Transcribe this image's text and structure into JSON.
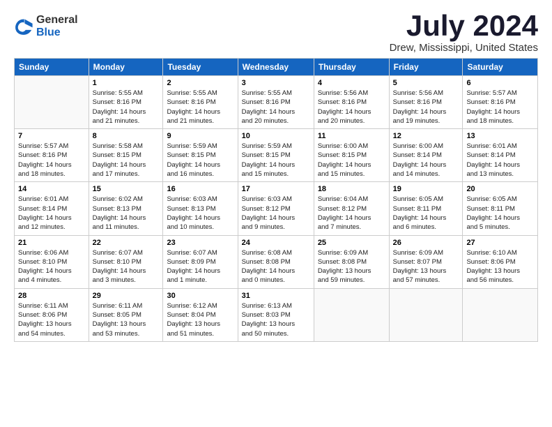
{
  "header": {
    "logo_general": "General",
    "logo_blue": "Blue",
    "month_title": "July 2024",
    "location": "Drew, Mississippi, United States"
  },
  "days_of_week": [
    "Sunday",
    "Monday",
    "Tuesday",
    "Wednesday",
    "Thursday",
    "Friday",
    "Saturday"
  ],
  "weeks": [
    [
      {
        "day": "",
        "info": ""
      },
      {
        "day": "1",
        "info": "Sunrise: 5:55 AM\nSunset: 8:16 PM\nDaylight: 14 hours\nand 21 minutes."
      },
      {
        "day": "2",
        "info": "Sunrise: 5:55 AM\nSunset: 8:16 PM\nDaylight: 14 hours\nand 21 minutes."
      },
      {
        "day": "3",
        "info": "Sunrise: 5:55 AM\nSunset: 8:16 PM\nDaylight: 14 hours\nand 20 minutes."
      },
      {
        "day": "4",
        "info": "Sunrise: 5:56 AM\nSunset: 8:16 PM\nDaylight: 14 hours\nand 20 minutes."
      },
      {
        "day": "5",
        "info": "Sunrise: 5:56 AM\nSunset: 8:16 PM\nDaylight: 14 hours\nand 19 minutes."
      },
      {
        "day": "6",
        "info": "Sunrise: 5:57 AM\nSunset: 8:16 PM\nDaylight: 14 hours\nand 18 minutes."
      }
    ],
    [
      {
        "day": "7",
        "info": "Sunrise: 5:57 AM\nSunset: 8:16 PM\nDaylight: 14 hours\nand 18 minutes."
      },
      {
        "day": "8",
        "info": "Sunrise: 5:58 AM\nSunset: 8:15 PM\nDaylight: 14 hours\nand 17 minutes."
      },
      {
        "day": "9",
        "info": "Sunrise: 5:59 AM\nSunset: 8:15 PM\nDaylight: 14 hours\nand 16 minutes."
      },
      {
        "day": "10",
        "info": "Sunrise: 5:59 AM\nSunset: 8:15 PM\nDaylight: 14 hours\nand 15 minutes."
      },
      {
        "day": "11",
        "info": "Sunrise: 6:00 AM\nSunset: 8:15 PM\nDaylight: 14 hours\nand 15 minutes."
      },
      {
        "day": "12",
        "info": "Sunrise: 6:00 AM\nSunset: 8:14 PM\nDaylight: 14 hours\nand 14 minutes."
      },
      {
        "day": "13",
        "info": "Sunrise: 6:01 AM\nSunset: 8:14 PM\nDaylight: 14 hours\nand 13 minutes."
      }
    ],
    [
      {
        "day": "14",
        "info": "Sunrise: 6:01 AM\nSunset: 8:14 PM\nDaylight: 14 hours\nand 12 minutes."
      },
      {
        "day": "15",
        "info": "Sunrise: 6:02 AM\nSunset: 8:13 PM\nDaylight: 14 hours\nand 11 minutes."
      },
      {
        "day": "16",
        "info": "Sunrise: 6:03 AM\nSunset: 8:13 PM\nDaylight: 14 hours\nand 10 minutes."
      },
      {
        "day": "17",
        "info": "Sunrise: 6:03 AM\nSunset: 8:12 PM\nDaylight: 14 hours\nand 9 minutes."
      },
      {
        "day": "18",
        "info": "Sunrise: 6:04 AM\nSunset: 8:12 PM\nDaylight: 14 hours\nand 7 minutes."
      },
      {
        "day": "19",
        "info": "Sunrise: 6:05 AM\nSunset: 8:11 PM\nDaylight: 14 hours\nand 6 minutes."
      },
      {
        "day": "20",
        "info": "Sunrise: 6:05 AM\nSunset: 8:11 PM\nDaylight: 14 hours\nand 5 minutes."
      }
    ],
    [
      {
        "day": "21",
        "info": "Sunrise: 6:06 AM\nSunset: 8:10 PM\nDaylight: 14 hours\nand 4 minutes."
      },
      {
        "day": "22",
        "info": "Sunrise: 6:07 AM\nSunset: 8:10 PM\nDaylight: 14 hours\nand 3 minutes."
      },
      {
        "day": "23",
        "info": "Sunrise: 6:07 AM\nSunset: 8:09 PM\nDaylight: 14 hours\nand 1 minute."
      },
      {
        "day": "24",
        "info": "Sunrise: 6:08 AM\nSunset: 8:08 PM\nDaylight: 14 hours\nand 0 minutes."
      },
      {
        "day": "25",
        "info": "Sunrise: 6:09 AM\nSunset: 8:08 PM\nDaylight: 13 hours\nand 59 minutes."
      },
      {
        "day": "26",
        "info": "Sunrise: 6:09 AM\nSunset: 8:07 PM\nDaylight: 13 hours\nand 57 minutes."
      },
      {
        "day": "27",
        "info": "Sunrise: 6:10 AM\nSunset: 8:06 PM\nDaylight: 13 hours\nand 56 minutes."
      }
    ],
    [
      {
        "day": "28",
        "info": "Sunrise: 6:11 AM\nSunset: 8:06 PM\nDaylight: 13 hours\nand 54 minutes."
      },
      {
        "day": "29",
        "info": "Sunrise: 6:11 AM\nSunset: 8:05 PM\nDaylight: 13 hours\nand 53 minutes."
      },
      {
        "day": "30",
        "info": "Sunrise: 6:12 AM\nSunset: 8:04 PM\nDaylight: 13 hours\nand 51 minutes."
      },
      {
        "day": "31",
        "info": "Sunrise: 6:13 AM\nSunset: 8:03 PM\nDaylight: 13 hours\nand 50 minutes."
      },
      {
        "day": "",
        "info": ""
      },
      {
        "day": "",
        "info": ""
      },
      {
        "day": "",
        "info": ""
      }
    ]
  ]
}
